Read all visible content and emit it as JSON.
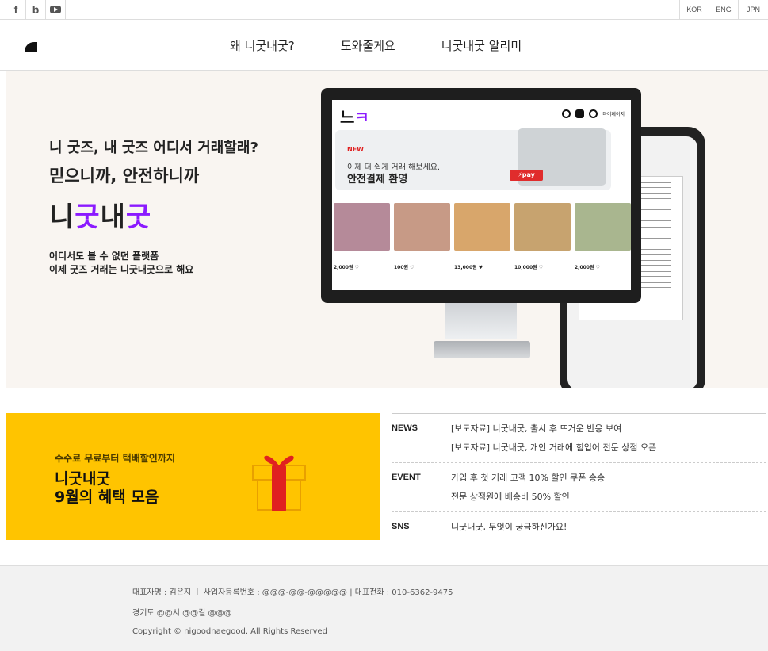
{
  "social": [
    "f",
    "b",
    "youtube-icon"
  ],
  "langs": [
    "KOR",
    "ENG",
    "JPN"
  ],
  "nav": [
    "왜 니굿내굿?",
    "도와줄게요",
    "니굿내굿 알리미"
  ],
  "hero": {
    "line1": "니 굿즈, 내 굿즈 어디서 거래할래?",
    "line2": "믿으니까, 안전하니까",
    "brand_a1": "니",
    "brand_b1": "굿",
    "brand_a2": "내",
    "brand_b2": "굿",
    "sub1": "어디서도 볼 수 없던 플랫폼",
    "sub2": "이제 굿즈 거래는 니굿내굿으로 해요"
  },
  "screen": {
    "logo_a": "느",
    "logo_b": "ㅋ",
    "mypage": "마이페이지",
    "new": "NEW",
    "banner1": "이제 더 쉽게 거래 해보세요.",
    "banner2": "안전결제 환영",
    "pay": "⚡pay",
    "cards": [
      {
        "price": "2,000원 ♡",
        "color": "#b58a99"
      },
      {
        "price": "100원 ♡",
        "color": "#c79a86"
      },
      {
        "price": "13,000원 ♥",
        "color": "#d8a66b"
      },
      {
        "price": "10,000원 ♡",
        "color": "#c7a36f"
      },
      {
        "price": "2,000원 ♡",
        "color": "#a9b68f"
      }
    ]
  },
  "promo": {
    "small": "수수료 무료부터 택배할인까지",
    "t1": "니굿내굿",
    "t2": "9월의 혜택 모음"
  },
  "news": [
    {
      "cat": "NEWS",
      "items": [
        "[보도자료] 니굿내굿, 출시 후 뜨거운 반응 보여",
        "[보도자료] 니굿내굿, 개인 거래에 힘입어 전문 상점 오픈"
      ]
    },
    {
      "cat": "EVENT",
      "items": [
        "가입 후 첫 거래 고객 10% 할인 쿠폰 송송",
        "전문 상점원에 배송비 50% 할인"
      ]
    },
    {
      "cat": "SNS",
      "items": [
        "니굿내굿, 무엇이 궁금하신가요!"
      ]
    }
  ],
  "footer": {
    "line1": "대표자명 : 김은지  ㅣ  사업자등록번호 : @@@-@@-@@@@@  |  대표전화 : 010-6362-9475",
    "line2": "경기도 @@시 @@길 @@@",
    "line3": "Copyright © nigoodnaegood. All Rights Reserved"
  }
}
